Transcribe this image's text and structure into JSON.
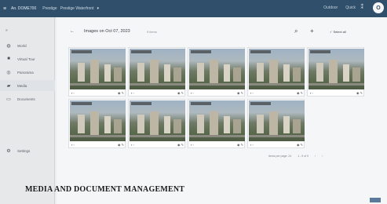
{
  "topbar": {
    "project": "An. DOME700",
    "crumb1": "Prestige",
    "crumb2": "Prestige Waterfront",
    "right_item1": "Outdoor",
    "right_item2": "Quick",
    "avatar": "O"
  },
  "sidebar": {
    "items": [
      {
        "label": "World",
        "icon": "globe-icon"
      },
      {
        "label": "Virtual Tour",
        "icon": "camera-icon"
      },
      {
        "label": "Panorama",
        "icon": "panorama-icon"
      },
      {
        "label": "Media",
        "icon": "media-icon",
        "active": true
      },
      {
        "label": "Documents",
        "icon": "document-icon"
      }
    ],
    "settings_label": "Settings"
  },
  "header": {
    "title": "Images on Oct 07, 2023",
    "count": "9 items",
    "select_all": "Select all"
  },
  "images": [
    {
      "id": 1
    },
    {
      "id": 2
    },
    {
      "id": 3
    },
    {
      "id": 4
    },
    {
      "id": 5
    },
    {
      "id": 6
    },
    {
      "id": 7
    },
    {
      "id": 8
    },
    {
      "id": 9
    }
  ],
  "pager": {
    "rows_per_page": "Items per page: 24",
    "range": "1 - 9 of 9"
  },
  "caption": "MEDIA AND DOCUMENT MANAGEMENT"
}
